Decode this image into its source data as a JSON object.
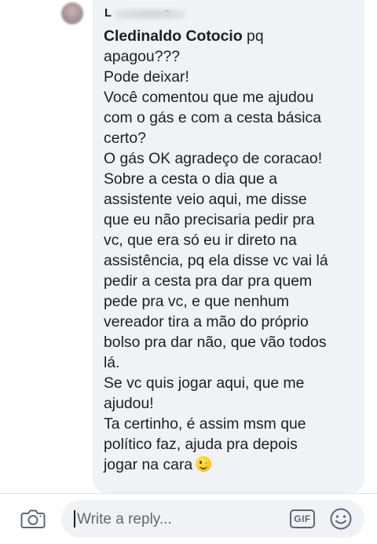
{
  "comment": {
    "author_visible": "L                a",
    "mention": "Cledinaldo Cotocio",
    "lines": [
      " pq",
      "apagou???",
      "Pode deixar!",
      "Você comentou que me ajudou",
      "com o gás e com a cesta básica",
      "certo?",
      "O gás OK agradeço de coracao!",
      "Sobre a cesta o dia que a",
      "assistente veio aqui, me disse",
      "que eu não precisaria pedir pra",
      "vc, que era só eu ir direto na",
      "assistência, pq ela disse vc vai lá",
      "pedir a cesta pra dar pra quem",
      "pede pra vc, e que nenhum",
      "vereador tira a mão do próprio",
      "bolso pra dar não, que vão todos",
      "lá.",
      "Se vc quis jogar aqui, que me",
      "ajudou!",
      "Ta certinho, é assim msm que",
      "político faz, ajuda pra depois",
      "jogar na cara"
    ],
    "end_emoji": "winking-face-emoji"
  },
  "composer": {
    "placeholder": "Write a reply...",
    "gif_label": "GIF",
    "icons": [
      "camera-icon",
      "gif-icon",
      "smiley-icon"
    ]
  }
}
